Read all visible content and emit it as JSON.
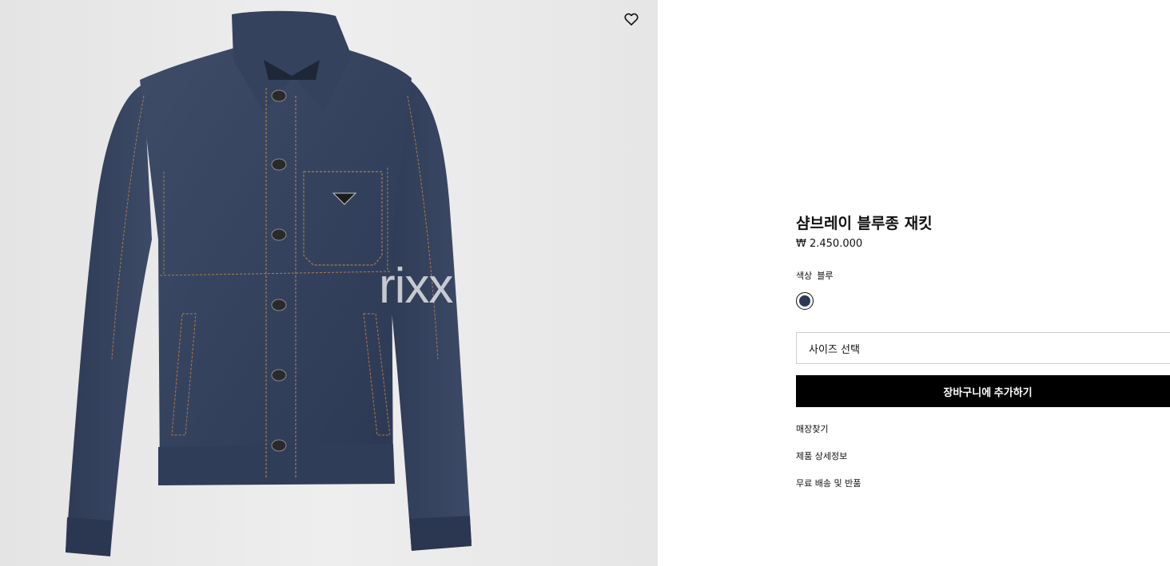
{
  "product": {
    "title": "샴브레이 블루종 재킷",
    "price": "₩ 2.450.000",
    "watermark": "rixx",
    "image_icon": "denim-jacket-image"
  },
  "wishlist": {
    "icon": "heart-icon"
  },
  "color": {
    "label": "색상",
    "value": "블루",
    "swatch_color": "#2c3a55"
  },
  "size_select": {
    "placeholder": "사이즈 선택"
  },
  "add_to_cart": {
    "label": "장바구니에 추가하기"
  },
  "links": {
    "store_finder": "매장찾기",
    "product_details": "제품 상세정보",
    "shipping_returns": "무료 배송 및 반품"
  }
}
